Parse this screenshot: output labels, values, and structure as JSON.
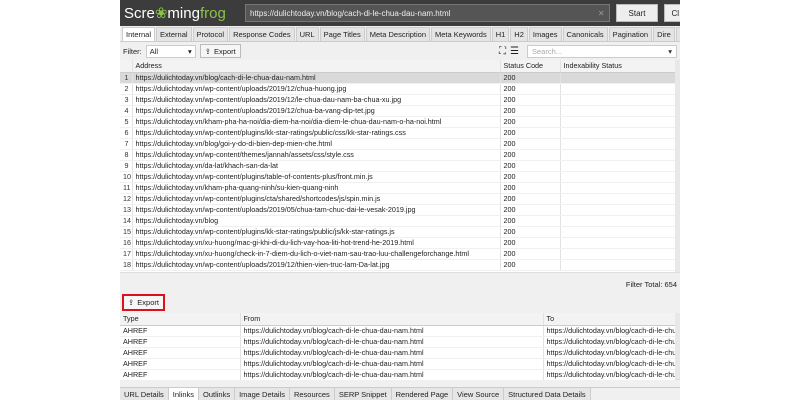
{
  "app": {
    "logo": "Screamingfrog",
    "url": "https://dulichtoday.vn/blog/cach-di-le-chua-dau-nam.html",
    "start": "Start",
    "clear": "Cl"
  },
  "tabs": [
    "Internal",
    "External",
    "Protocol",
    "Response Codes",
    "URL",
    "Page Titles",
    "Meta Description",
    "Meta Keywords",
    "H1",
    "H2",
    "Images",
    "Canonicals",
    "Pagination",
    "Dire"
  ],
  "filter": {
    "label": "Filter:",
    "value": "All",
    "export": "Export",
    "search_placeholder": "Search..."
  },
  "main_table": {
    "columns": [
      "Address",
      "Status Code",
      "Indexability Status"
    ],
    "rows": [
      [
        "1",
        "https://dulichtoday.vn/blog/cach-di-le-chua-dau-nam.html",
        "200"
      ],
      [
        "2",
        "https://dulichtoday.vn/wp-content/uploads/2019/12/chua-huong.jpg",
        "200"
      ],
      [
        "3",
        "https://dulichtoday.vn/wp-content/uploads/2019/12/le-chua-dau-nam-ba-chua-xu.jpg",
        "200"
      ],
      [
        "4",
        "https://dulichtoday.vn/wp-content/uploads/2019/12/chua-ba-vang-dip-tet.jpg",
        "200"
      ],
      [
        "5",
        "https://dulichtoday.vn/kham-pha-ha-noi/dia-diem-ha-noi/dia-diem-le-chua-dau-nam-o-ha-noi.html",
        "200"
      ],
      [
        "6",
        "https://dulichtoday.vn/wp-content/plugins/kk-star-ratings/public/css/kk-star-ratings.css",
        "200"
      ],
      [
        "7",
        "https://dulichtoday.vn/blog/goi-y-do-di-bien-dep-mien-che.html",
        "200"
      ],
      [
        "8",
        "https://dulichtoday.vn/wp-content/themes/jannah/assets/css/style.css",
        "200"
      ],
      [
        "9",
        "https://dulichtoday.vn/da-lat/khach-san-da-lat",
        "200"
      ],
      [
        "10",
        "https://dulichtoday.vn/wp-content/plugins/table-of-contents-plus/front.min.js",
        "200"
      ],
      [
        "11",
        "https://dulichtoday.vn/kham-pha-quang-ninh/su-kien-quang-ninh",
        "200"
      ],
      [
        "12",
        "https://dulichtoday.vn/wp-content/plugins/cta/shared/shortcodes/js/spin.min.js",
        "200"
      ],
      [
        "13",
        "https://dulichtoday.vn/wp-content/uploads/2019/05/chua-tam-chuc-dai-le-vesak-2019.jpg",
        "200"
      ],
      [
        "14",
        "https://dulichtoday.vn/blog",
        "200"
      ],
      [
        "15",
        "https://dulichtoday.vn/wp-content/plugins/kk-star-ratings/public/js/kk-star-ratings.js",
        "200"
      ],
      [
        "16",
        "https://dulichtoday.vn/xu-huong/mac-gi-khi-di-du-lich-vay-hoa-liti-hot-trend-he-2019.html",
        "200"
      ],
      [
        "17",
        "https://dulichtoday.vn/xu-huong/check-in-7-diem-du-lich-o-viet-nam-sau-trao-luu-challengeforchange.html",
        "200"
      ],
      [
        "18",
        "https://dulichtoday.vn/wp-content/uploads/2019/12/thien-vien-truc-lam-Da-lat.jpg",
        "200"
      ]
    ]
  },
  "filter_total": "Filter Total:  654",
  "lower": {
    "export": "Export",
    "columns": [
      "Type",
      "From",
      "To"
    ],
    "rows": [
      [
        "AHREF",
        "https://dulichtoday.vn/blog/cach-di-le-chua-dau-nam.html",
        "https://dulichtoday.vn/blog/cach-di-le-chu"
      ],
      [
        "AHREF",
        "https://dulichtoday.vn/blog/cach-di-le-chua-dau-nam.html",
        "https://dulichtoday.vn/blog/cach-di-le-chu"
      ],
      [
        "AHREF",
        "https://dulichtoday.vn/blog/cach-di-le-chua-dau-nam.html",
        "https://dulichtoday.vn/blog/cach-di-le-chu"
      ],
      [
        "AHREF",
        "https://dulichtoday.vn/blog/cach-di-le-chua-dau-nam.html",
        "https://dulichtoday.vn/blog/cach-di-le-chu"
      ],
      [
        "AHREF",
        "https://dulichtoday.vn/blog/cach-di-le-chua-dau-nam.html",
        "https://dulichtoday.vn/blog/cach-di-le-chu"
      ]
    ]
  },
  "bottom_tabs": [
    "URL Details",
    "Inlinks",
    "Outlinks",
    "Image Details",
    "Resources",
    "SERP Snippet",
    "Rendered Page",
    "View Source",
    "Structured Data Details"
  ],
  "colors": {
    "highlight": "#e0101a",
    "logo_green": "#8bc34a",
    "header": "#3c3c3c"
  }
}
